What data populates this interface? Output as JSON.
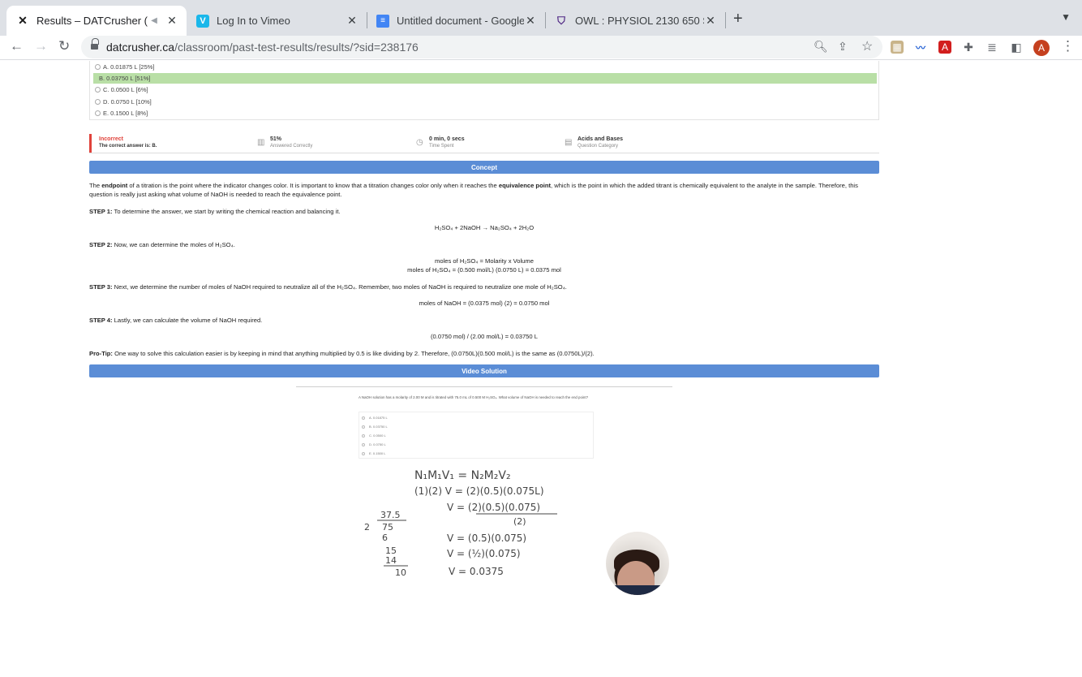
{
  "browser": {
    "tabs": [
      {
        "title": "Results – DATCrusher (Can",
        "icon": "datcrusher-x-icon",
        "active": true
      },
      {
        "title": "Log In to Vimeo",
        "icon": "vimeo-icon",
        "active": false
      },
      {
        "title": "Untitled document - Google Do",
        "icon": "google-docs-icon",
        "active": false
      },
      {
        "title": "OWL : PHYSIOL 2130 650 SU2",
        "icon": "owl-icon",
        "active": false
      }
    ],
    "url_host": "datcrusher.ca",
    "url_path": "/classroom/past-test-results/results/?sid=238176",
    "profile_initial": "A"
  },
  "choices": [
    {
      "label": "A. 0.01875 L [25%]",
      "correct": false
    },
    {
      "label": "B. 0.03750 L [51%]",
      "correct": true
    },
    {
      "label": "C. 0.0500 L [6%]",
      "correct": false
    },
    {
      "label": "D. 0.0750 L [10%]",
      "correct": false
    },
    {
      "label": "E. 0.1500 L [8%]",
      "correct": false
    }
  ],
  "result": {
    "status": "Incorrect",
    "correct_answer": "The correct answer is: B.",
    "percent": "51%",
    "percent_label": "Answered Correctly",
    "time": "0 min, 0 secs",
    "time_label": "Time Spent",
    "category": "Acids and Bases",
    "category_label": "Question Category"
  },
  "concept": {
    "header": "Concept",
    "intro_a": "The ",
    "intro_b": "endpoint",
    "intro_c": " of a titration is the point where the indicator changes color. It is important to know that a titration changes color only when it reaches the ",
    "intro_d": "equivalence point",
    "intro_e": ", which is the point in which the added titrant is chemically equivalent to the analyte in the sample. Therefore, this question is really just asking what volume of NaOH is needed to reach the equivalence point.",
    "step1_label": "STEP 1:",
    "step1_text": " To determine the answer, we start by writing the chemical reaction and balancing it.",
    "eq1": "H₂SO₄ + 2NaOH → Na₂SO₄ + 2H₂O",
    "step2_label": "STEP 2:",
    "step2_text": " Now, we can determine the moles of H₂SO₄.",
    "eq2a": "moles of H₂SO₄ = Molarity x Volume",
    "eq2b": "moles of H₂SO₄ = (0.500 mol/L) (0.0750 L) = 0.0375 mol",
    "step3_label": "STEP 3:",
    "step3_text": " Next, we determine the number of moles of NaOH required to neutralize all of the H₂SO₄. Remember, two moles of NaOH is required to neutralize one mole of H₂SO₄.",
    "eq3": "moles of NaOH = (0.0375 mol) (2) = 0.0750 mol",
    "step4_label": "STEP 4:",
    "step4_text": " Lastly, we can calculate the volume of NaOH required.",
    "eq4": "(0.0750 mol) / (2.00 mol/L) = 0.03750 L",
    "protip_label": "Pro-Tip:",
    "protip_text": " One way to solve this calculation easier is by keeping in mind that anything multiplied by 0.5 is like dividing by 2. Therefore, (0.0750L)(0.500 mol/L) is the same as (0.0750L)/(2)."
  },
  "video": {
    "header": "Video Solution",
    "question": "A NaOH solution has a molarity of 2.00 M and is titrated with 75.0 mL of 0.500 M H₂SO₄. What volume of NaOH is needed to reach the end point?",
    "options": [
      "A. 0.01875 L",
      "B. 0.03750 L",
      "C. 0.0500 L",
      "D. 0.0750 L",
      "E. 0.1500 L"
    ],
    "hw_line1": "N₁M₁V₁ = N₂M₂V₂",
    "hw_line2": "(1)(2) V = (2)(0.5)(0.075L)",
    "hw_line3": "V = (2)(0.5)(0.075)",
    "hw_line3b": "(2)",
    "hw_line4": "V = (0.5)(0.075)",
    "hw_line5": "V = (½)(0.075)",
    "hw_line6": "V = 0.0375",
    "hw_div_q": "37.5",
    "hw_div_d": "2",
    "hw_div_n": "75",
    "hw_div_r1": "6",
    "hw_div_r2": "15",
    "hw_div_r3": "14",
    "hw_div_r4": "10"
  }
}
